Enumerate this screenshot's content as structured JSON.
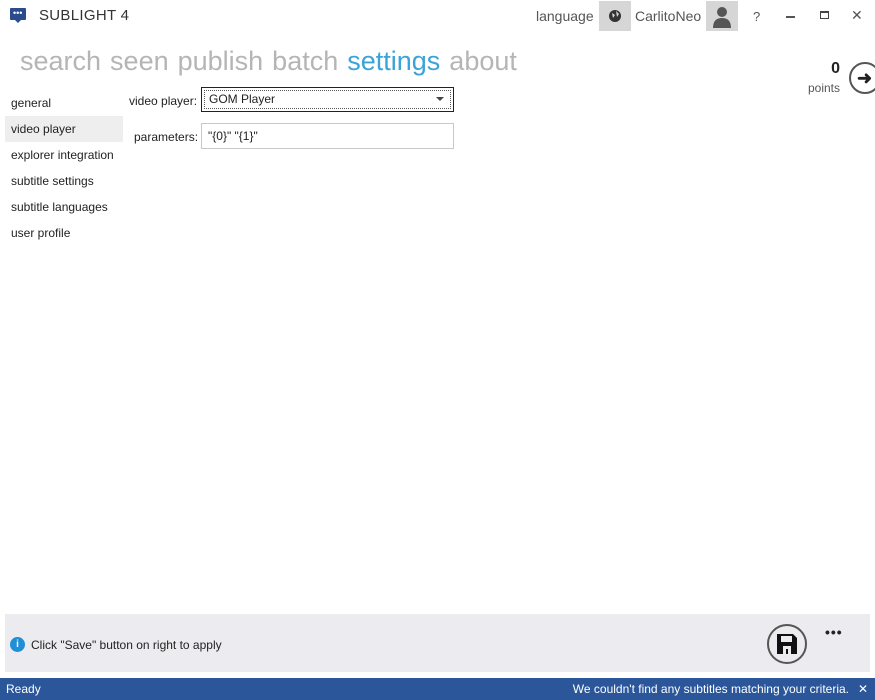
{
  "app": {
    "title": "SUBLIGHT 4",
    "icon": "chat-bubble-icon"
  },
  "titlebar": {
    "language": "language",
    "user": "CarlitoNeo",
    "help": "?"
  },
  "nav": [
    "search",
    "seen",
    "publish",
    "batch",
    "settings",
    "about"
  ],
  "nav_active": "settings",
  "points": {
    "value": "0",
    "label": "points"
  },
  "sidebar": {
    "items": [
      {
        "label": "general"
      },
      {
        "label": "video player"
      },
      {
        "label": "explorer integration"
      },
      {
        "label": "subtitle settings"
      },
      {
        "label": "subtitle languages"
      },
      {
        "label": "user profile"
      }
    ],
    "selected": "video player"
  },
  "form": {
    "video_player_label": "video player:",
    "video_player_value": "GOM Player",
    "parameters_label": "parameters:",
    "parameters_value": "\"{0}\" \"{1}\""
  },
  "footer": {
    "info": "Click \"Save\" button on right to apply",
    "more": "•••"
  },
  "status": {
    "left": "Ready",
    "right": "We couldn't find any subtitles matching your criteria.",
    "close": "✕"
  },
  "colors": {
    "accent": "#3aa3d7",
    "statusbar": "#2b579a"
  }
}
